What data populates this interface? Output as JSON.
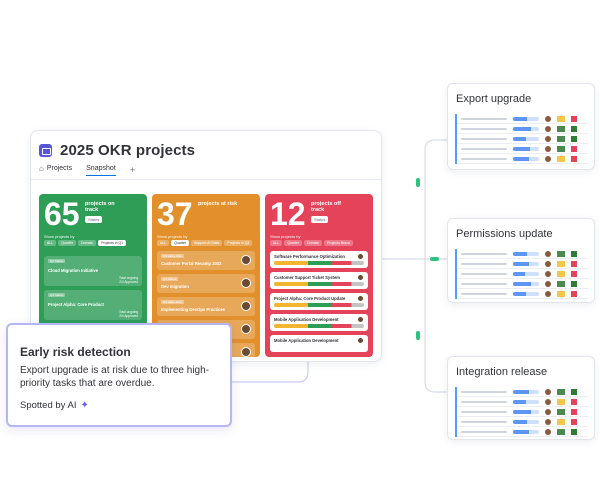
{
  "okr_board": {
    "title": "2025 OKR projects",
    "tabs": [
      {
        "label": "Projects",
        "icon": "home-icon"
      },
      {
        "label": "Snapshot"
      }
    ],
    "add_tab": "+",
    "columns": [
      {
        "count": "65",
        "label": "projects on track",
        "pill": "Status",
        "filter_label": "Show projects by",
        "chips": [
          "ALL",
          "Quarter",
          "Domain",
          "Projects in Q1"
        ],
        "color": "#2e9e57",
        "cards": [
          {
            "tag": "Q2 Status",
            "title": "Cloud Migration Initiative",
            "meta": "Total ongoing\n2/4 Approved"
          },
          {
            "tag": "Q1 Status",
            "title": "Project Alpha: Core Product",
            "meta": "Total ongoing\n2/4 Approved"
          }
        ]
      },
      {
        "count": "37",
        "label": "projects at risk",
        "pill": "",
        "filter_label": "Show projects by",
        "chips": [
          "ALL",
          "Quarter",
          "Support AI Stats",
          "Projects in Q1"
        ],
        "color": "#e2902b",
        "cards": [
          {
            "tag": "Q3 sales data",
            "title": "Customer Portal Revamp 2022"
          },
          {
            "tag": "Q4 Status",
            "title": "Dev migration"
          },
          {
            "tag": "Q1 sales data",
            "title": "Implementing DevOps Practices"
          },
          {
            "tag": "",
            "title": ""
          },
          {
            "tag": "",
            "title": ""
          }
        ]
      },
      {
        "count": "12",
        "label": "projects off track",
        "pill": "Status",
        "filter_label": "Show projects by",
        "chips": [
          "ALL",
          "Quarter",
          "Domain",
          "Projects Bravo"
        ],
        "color": "#e4435a",
        "cards": [
          {
            "title": "Software Performance Optimization"
          },
          {
            "title": "Customer Support Ticket System"
          },
          {
            "title": "Project Alpha: Core Product Update"
          },
          {
            "title": "Mobile Application Development"
          },
          {
            "title": "Mobile Application Development"
          }
        ]
      }
    ]
  },
  "task_cards": [
    {
      "title": "Export upgrade",
      "rows": [
        {
          "progress": 0.55,
          "status": [
            "#f2c84b",
            "#e4435a"
          ]
        },
        {
          "progress": 0.7,
          "status": [
            "#4a8a4f",
            "#2e7d32"
          ]
        },
        {
          "progress": 0.5,
          "status": [
            "#4a8a4f",
            "#2e7d32"
          ]
        },
        {
          "progress": 0.65,
          "status": [
            "#4a8a4f",
            "#e4435a"
          ]
        },
        {
          "progress": 0.6,
          "status": [
            "#f2c84b",
            "#e4435a"
          ]
        }
      ]
    },
    {
      "title": "Permissions update",
      "rows": [
        {
          "progress": 0.55,
          "status": [
            "#4a8a4f",
            "#2e7d32"
          ]
        },
        {
          "progress": 0.6,
          "status": [
            "#f2c84b",
            "#e4435a"
          ]
        },
        {
          "progress": 0.45,
          "status": [
            "#f2c84b",
            "#e4435a"
          ]
        },
        {
          "progress": 0.7,
          "status": [
            "#4a8a4f",
            "#2e7d32"
          ]
        },
        {
          "progress": 0.5,
          "status": [
            "#f2c84b",
            "#e4435a"
          ]
        }
      ]
    },
    {
      "title": "Integration release",
      "rows": [
        {
          "progress": 0.6,
          "status": [
            "#4a8a4f",
            "#2e7d32"
          ]
        },
        {
          "progress": 0.5,
          "status": [
            "#f2c84b",
            "#e4435a"
          ]
        },
        {
          "progress": 0.7,
          "status": [
            "#4a8a4f",
            "#e4435a"
          ]
        },
        {
          "progress": 0.55,
          "status": [
            "#f2c84b",
            "#e4435a"
          ]
        },
        {
          "progress": 0.6,
          "status": [
            "#4a8a4f",
            "#2e7d32"
          ]
        }
      ]
    }
  ],
  "risk_panel": {
    "title": "Early risk detection",
    "body": "Export upgrade is at risk due to three high-priority tasks that are overdue.",
    "footer": "Spotted by AI",
    "footer_icon": "sparkle-icon"
  }
}
